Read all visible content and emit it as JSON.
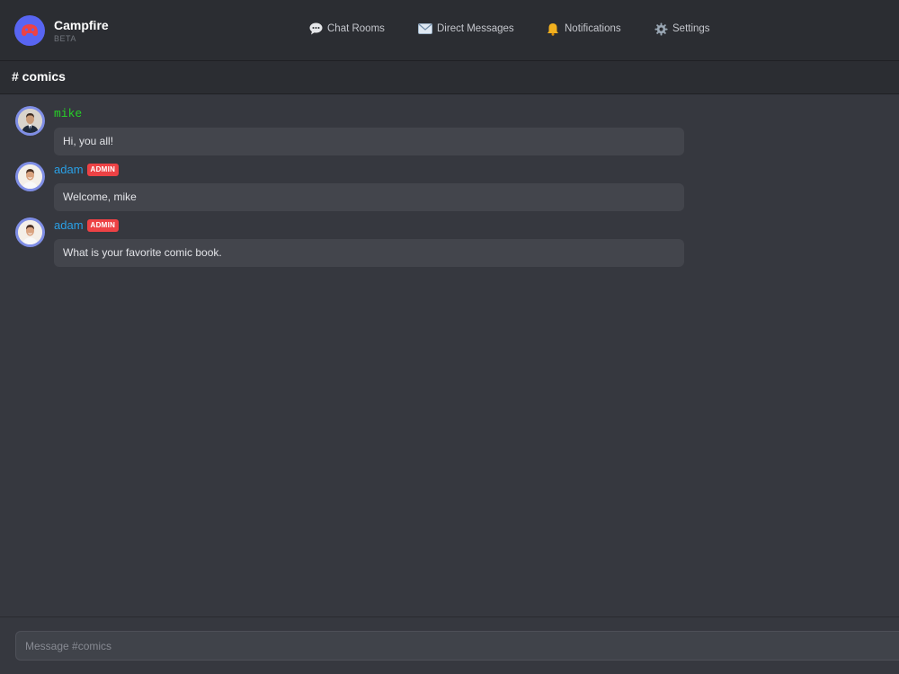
{
  "app": {
    "name": "Campfire",
    "tag": "BETA",
    "logo_icon": "game-controller-icon",
    "accent_color": "#5865f2"
  },
  "nav": [
    {
      "label": "Chat Rooms",
      "icon": "speech-bubble-icon"
    },
    {
      "label": "Direct Messages",
      "icon": "envelope-icon"
    },
    {
      "label": "Notifications",
      "icon": "bell-icon"
    },
    {
      "label": "Settings",
      "icon": "gear-icon"
    }
  ],
  "channel": {
    "title": "# comics"
  },
  "messages": [
    {
      "author": "mike",
      "role_badge": "",
      "text": "Hi, you all!",
      "author_color": "#27d127"
    },
    {
      "author": "adam",
      "role_badge": "ADMIN",
      "text": "Welcome, mike",
      "author_color": "#2aa0e6"
    },
    {
      "author": "adam",
      "role_badge": "ADMIN",
      "text": "What is your favorite comic book.",
      "author_color": "#2aa0e6"
    }
  ],
  "composer": {
    "placeholder": "Message #comics",
    "value": ""
  }
}
